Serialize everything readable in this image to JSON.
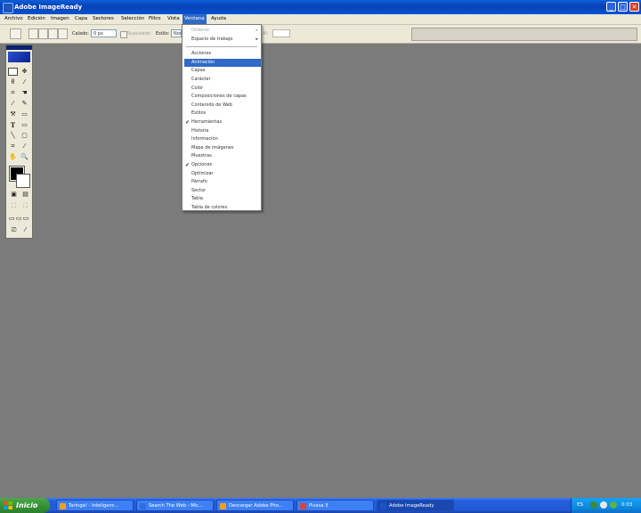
{
  "window": {
    "title": "Adobe ImageReady",
    "controls": {
      "minimize": "_",
      "maximize": "□",
      "close": "✕"
    }
  },
  "menubar": [
    {
      "label": "Archivo",
      "active": false
    },
    {
      "label": "Edición",
      "active": false
    },
    {
      "label": "Imagen",
      "active": false
    },
    {
      "label": "Capa",
      "active": false
    },
    {
      "label": "Sectores",
      "active": false
    },
    {
      "label": "Selección",
      "active": false
    },
    {
      "label": "Filtro",
      "active": false
    },
    {
      "label": "Vista",
      "active": false
    },
    {
      "label": "Ventana",
      "active": true
    },
    {
      "label": "Ayuda",
      "active": false
    }
  ],
  "options_bar": {
    "feather_label": "Calado:",
    "feather_value": "0 px",
    "antialias_label": "Suavizado",
    "style_label": "Estilo:",
    "style_value": "Normal",
    "width_label": "An:",
    "height_label": "Al:"
  },
  "ventana_menu": {
    "items": [
      {
        "label": "Ordenar",
        "disabled": true,
        "submenu": true
      },
      {
        "label": "Espacio de trabajo",
        "submenu": true
      },
      {
        "separator": true
      },
      {
        "label": "Acciones"
      },
      {
        "label": "Animación",
        "highlighted": true
      },
      {
        "label": "Capas"
      },
      {
        "label": "Carácter"
      },
      {
        "label": "Color"
      },
      {
        "label": "Composiciones de capas"
      },
      {
        "label": "Contenido de Web"
      },
      {
        "label": "Estilos"
      },
      {
        "label": "Herramientas",
        "checked": true
      },
      {
        "label": "Historia"
      },
      {
        "label": "Información"
      },
      {
        "label": "Mapa de imágenes"
      },
      {
        "label": "Muestras"
      },
      {
        "label": "Opciones",
        "checked": true
      },
      {
        "label": "Optimizar"
      },
      {
        "label": "Párrafo"
      },
      {
        "label": "Sector"
      },
      {
        "label": "Tabla"
      },
      {
        "label": "Tabla de colores"
      }
    ]
  },
  "taskbar": {
    "start_label": "Inicio",
    "tasks": [
      {
        "label": "Taringa! - Inteligenc...",
        "icon_color": "#f2a019",
        "active": false
      },
      {
        "label": "Search The Web - Mic...",
        "icon_color": "#2e6fe0",
        "active": false
      },
      {
        "label": "Descargar Adobe Pho...",
        "icon_color": "#f2a019",
        "active": false
      },
      {
        "label": "Picasa 3",
        "icon_color": "#d8453a",
        "active": false
      },
      {
        "label": "Adobe ImageReady",
        "icon_color": "#1a56c8",
        "active": true
      }
    ],
    "language": "ES",
    "clock": "0:03"
  }
}
